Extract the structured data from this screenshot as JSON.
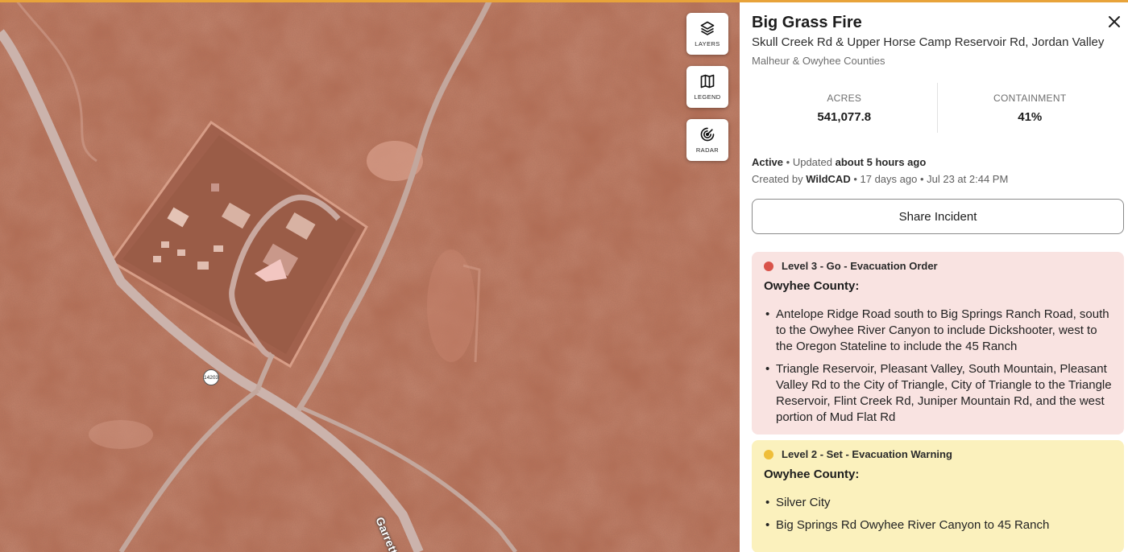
{
  "map": {
    "controls": [
      {
        "label": "LAYERS",
        "icon": "layers-icon"
      },
      {
        "label": "LEGEND",
        "icon": "map-icon"
      },
      {
        "label": "RADAR",
        "icon": "radar-icon"
      }
    ],
    "road_marker": "14203",
    "road_label": "Garrett Cr"
  },
  "incident": {
    "title": "Big Grass Fire",
    "address": "Skull Creek Rd & Upper Horse Camp Reservoir Rd, Jordan Valley",
    "counties": "Malheur & Owyhee Counties",
    "stats": [
      {
        "label": "ACRES",
        "value": "541,077.8"
      },
      {
        "label": "CONTAINMENT",
        "value": "41%"
      }
    ],
    "status": "Active",
    "updated_prefix": "• Updated",
    "updated_time": "about 5 hours ago",
    "created_prefix": "Created by",
    "created_by": "WildCAD",
    "created_age": "• 17 days ago • Jul 23 at 2:44 PM",
    "share_label": "Share Incident"
  },
  "zones": [
    {
      "level": "Level 3 - Go - Evacuation Order",
      "color": "#d9534a",
      "county": "Owyhee County:",
      "items": [
        "Antelope Ridge Road south to Big Springs Ranch Road, south to the Owyhee River Canyon to include Dickshooter, west to the Oregon Stateline to include the 45 Ranch",
        "Triangle Reservoir, Pleasant Valley, South Mountain, Pleasant Valley Rd to the City of Triangle, City of Triangle to the Triangle Reservoir, Flint Creek Rd, Juniper Mountain Rd, and the west portion of Mud Flat Rd"
      ]
    },
    {
      "level": "Level 2 - Set - Evacuation Warning",
      "color": "#efbe3a",
      "county": "Owyhee County:",
      "items": [
        "Silver City",
        "Big Springs Rd Owyhee River Canyon to 45 Ranch"
      ]
    }
  ]
}
